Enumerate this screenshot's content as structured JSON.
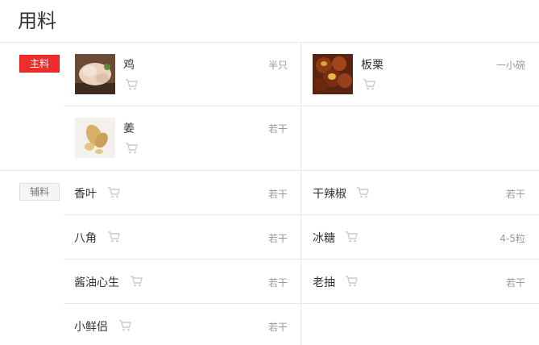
{
  "title": "用料",
  "sections": {
    "main_label": "主料",
    "aux_label": "辅料"
  },
  "main": [
    {
      "name": "鸡",
      "qty": "半只",
      "icon": "chicken-photo"
    },
    {
      "name": "板栗",
      "qty": "一小碗",
      "icon": "chestnut-photo"
    },
    {
      "name": "姜",
      "qty": "若干",
      "icon": "ginger-photo"
    }
  ],
  "aux": [
    {
      "name": "香叶",
      "qty": "若干"
    },
    {
      "name": "干辣椒",
      "qty": "若干"
    },
    {
      "name": "八角",
      "qty": "若干"
    },
    {
      "name": "冰糖",
      "qty": "4-5粒"
    },
    {
      "name": "酱油心生",
      "qty": "若干"
    },
    {
      "name": "老抽",
      "qty": "若干"
    },
    {
      "name": "小鲜侣",
      "qty": "若干"
    }
  ],
  "colors": {
    "accent": "#f02d2d",
    "muted": "#999999",
    "border": "#e8e8e8"
  }
}
